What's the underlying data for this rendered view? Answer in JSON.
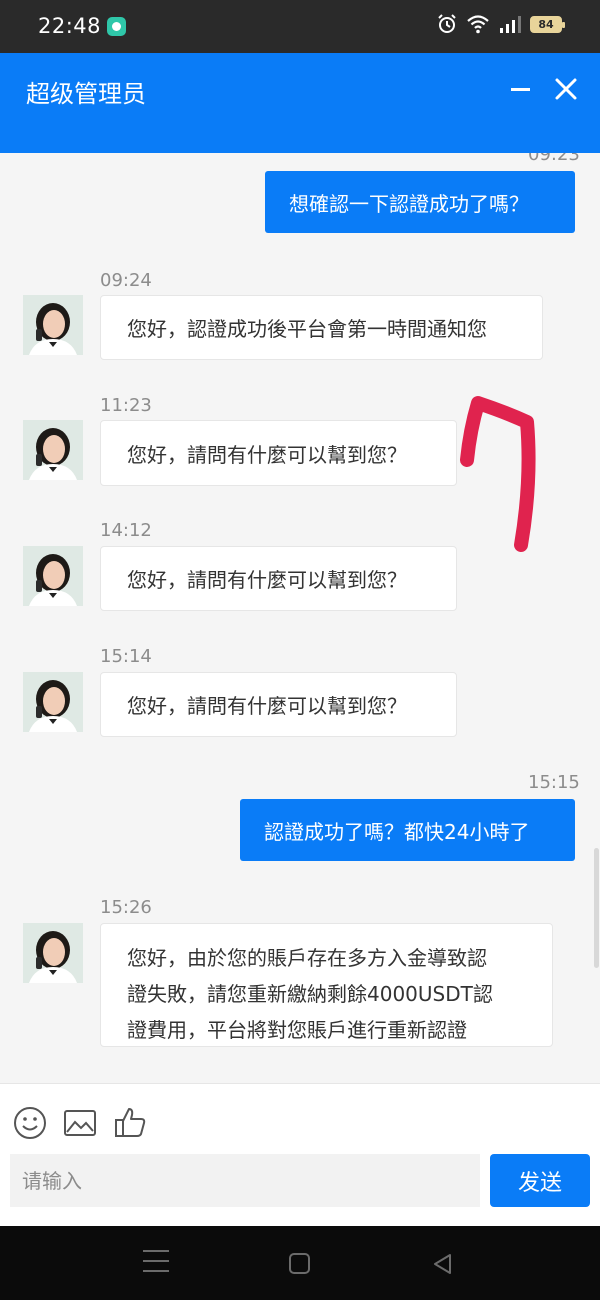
{
  "status_bar": {
    "time": "22:48",
    "battery": "84"
  },
  "header": {
    "title": "超级管理员"
  },
  "messages": [
    {
      "type": "out",
      "time": "09:23",
      "text": "想確認一下認證成功了嗎？"
    },
    {
      "type": "in",
      "time": "09:24",
      "text": "您好，認證成功後平台會第一時間通知您"
    },
    {
      "type": "in",
      "time": "11:23",
      "text": "您好，請問有什麼可以幫到您？"
    },
    {
      "type": "in",
      "time": "14:12",
      "text": "您好，請問有什麼可以幫到您？"
    },
    {
      "type": "in",
      "time": "15:14",
      "text": "您好，請問有什麼可以幫到您？"
    },
    {
      "type": "out",
      "time": "15:15",
      "text": "認證成功了嗎？都快24小時了"
    },
    {
      "type": "in",
      "time": "15:26",
      "lines": [
        "您好，由於您的賬戶存在多方入金導致認",
        "證失敗，請您重新繳納剩餘4000USDT認",
        "證費用，平台將對您賬戶進行重新認證"
      ]
    }
  ],
  "composer": {
    "placeholder": "请输入",
    "send_label": "发送"
  },
  "colors": {
    "accent": "#0a7cf7",
    "annotation": "#e0234e"
  }
}
